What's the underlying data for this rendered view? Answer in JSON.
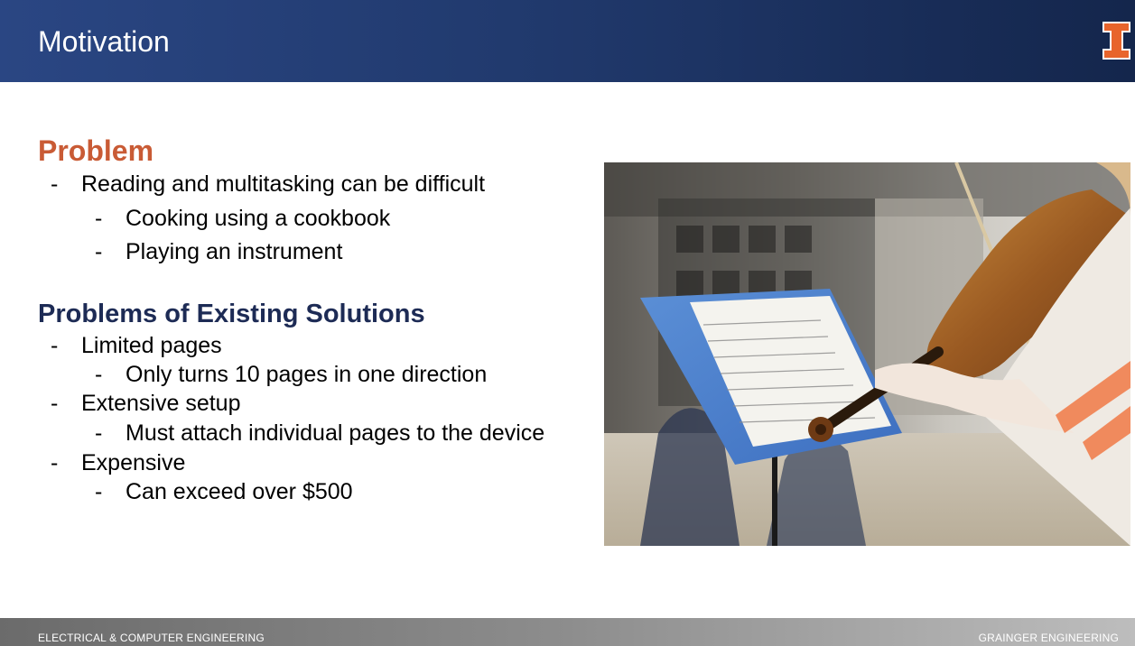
{
  "header": {
    "title": "Motivation",
    "logo_icon": "illinois-block-i-icon",
    "logo_color": "#e8642b"
  },
  "problem": {
    "heading": "Problem",
    "heading_color": "#c95b35",
    "items": [
      {
        "text": "Reading and multitasking can be difficult",
        "dash": "-"
      },
      {
        "text": "Cooking using a cookbook",
        "dash": "-"
      },
      {
        "text": "Playing an instrument",
        "dash": "-"
      }
    ]
  },
  "existing": {
    "heading": "Problems of Existing Solutions",
    "heading_color": "#1d2b55",
    "items": [
      {
        "text": "Limited pages",
        "dash": "-"
      },
      {
        "text": "Only turns 10 pages in one direction",
        "dash": "-"
      },
      {
        "text": "Extensive setup",
        "dash": "-"
      },
      {
        "text": "Must attach individual pages to the device",
        "dash": "-"
      },
      {
        "text": "Expensive",
        "dash": "-"
      },
      {
        "text": "Can exceed over $500",
        "dash": "-"
      }
    ]
  },
  "footer": {
    "left": "ELECTRICAL & COMPUTER ENGINEERING",
    "right": "GRAINGER ENGINEERING"
  }
}
